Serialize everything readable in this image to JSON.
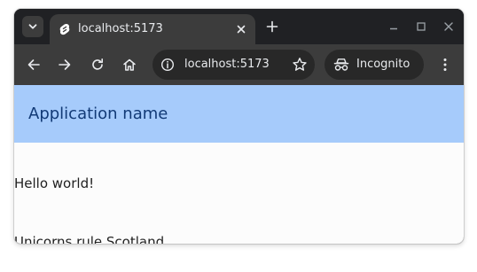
{
  "browser": {
    "tab": {
      "title": "localhost:5173",
      "favicon": "svelte-logo-icon"
    },
    "toolbar": {
      "url": "localhost:5173",
      "incognito_label": "Incognito"
    },
    "icons": {
      "tab_search": "chevron-down-icon",
      "tab_close": "close-icon",
      "new_tab": "plus-icon",
      "minimize": "minimize-icon",
      "maximize": "maximize-icon",
      "close_window": "close-icon",
      "back": "arrow-left-icon",
      "forward": "arrow-right-icon",
      "reload": "reload-icon",
      "home": "home-icon",
      "site_info": "info-icon",
      "bookmark": "star-icon",
      "incognito": "incognito-icon",
      "menu": "kebab-menu-icon"
    },
    "colors": {
      "frame": "#202124",
      "toolbar": "#3c3c3c",
      "omnibox": "#282828",
      "text": "#e8eaed"
    }
  },
  "page": {
    "header": {
      "app_name": "Application name",
      "background": "#a6cbfb",
      "text_color": "#123a76"
    },
    "lines": [
      "Hello world!",
      "Unicorns rule Scotland"
    ]
  }
}
